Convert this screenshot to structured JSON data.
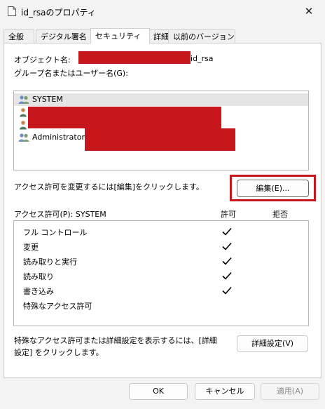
{
  "window": {
    "title": "id_rsaのプロパティ",
    "close_glyph": "✕"
  },
  "tabs": [
    {
      "label": "全般",
      "active": false
    },
    {
      "label": "デジタル署名",
      "active": false
    },
    {
      "label": "セキュリティ",
      "active": true
    },
    {
      "label": "詳細",
      "active": false
    },
    {
      "label": "以前のバージョン",
      "active": false
    }
  ],
  "security": {
    "object_name_label": "オブジェクト名:",
    "object_name_suffix": "id_rsa",
    "group_user_label": "グループ名またはユーザー名(G):",
    "users": [
      {
        "name": "SYSTEM",
        "icon": "users-group-icon",
        "selected": true
      },
      {
        "name": "",
        "icon": "user-icon",
        "selected": false
      },
      {
        "name": "",
        "icon": "user-icon",
        "selected": false
      },
      {
        "name": "Administrators",
        "icon": "users-group-icon",
        "selected": false
      }
    ],
    "change_permission_text": "アクセス許可を変更するには[編集]をクリックします。",
    "edit_button": "編集(E)...",
    "permissions_for_label": "アクセス許可(P): SYSTEM",
    "allow_header": "許可",
    "deny_header": "拒否",
    "permissions": [
      {
        "name": "フル コントロール",
        "allow": true,
        "deny": false
      },
      {
        "name": "変更",
        "allow": true,
        "deny": false
      },
      {
        "name": "読み取りと実行",
        "allow": true,
        "deny": false
      },
      {
        "name": "読み取り",
        "allow": true,
        "deny": false
      },
      {
        "name": "書き込み",
        "allow": true,
        "deny": false
      },
      {
        "name": "特殊なアクセス許可",
        "allow": false,
        "deny": false
      }
    ],
    "advanced_text_line1": "特殊なアクセス許可または詳細設定を表示するには、[詳細",
    "advanced_text_line2": "設定] をクリックします。",
    "advanced_button": "詳細設定(V)"
  },
  "footer": {
    "ok": "OK",
    "cancel": "キャンセル",
    "apply": "適用(A)"
  },
  "colors": {
    "redaction": "#c8161d",
    "highlight_border": "#c8161d",
    "selected_row": "#e5e5e5"
  }
}
